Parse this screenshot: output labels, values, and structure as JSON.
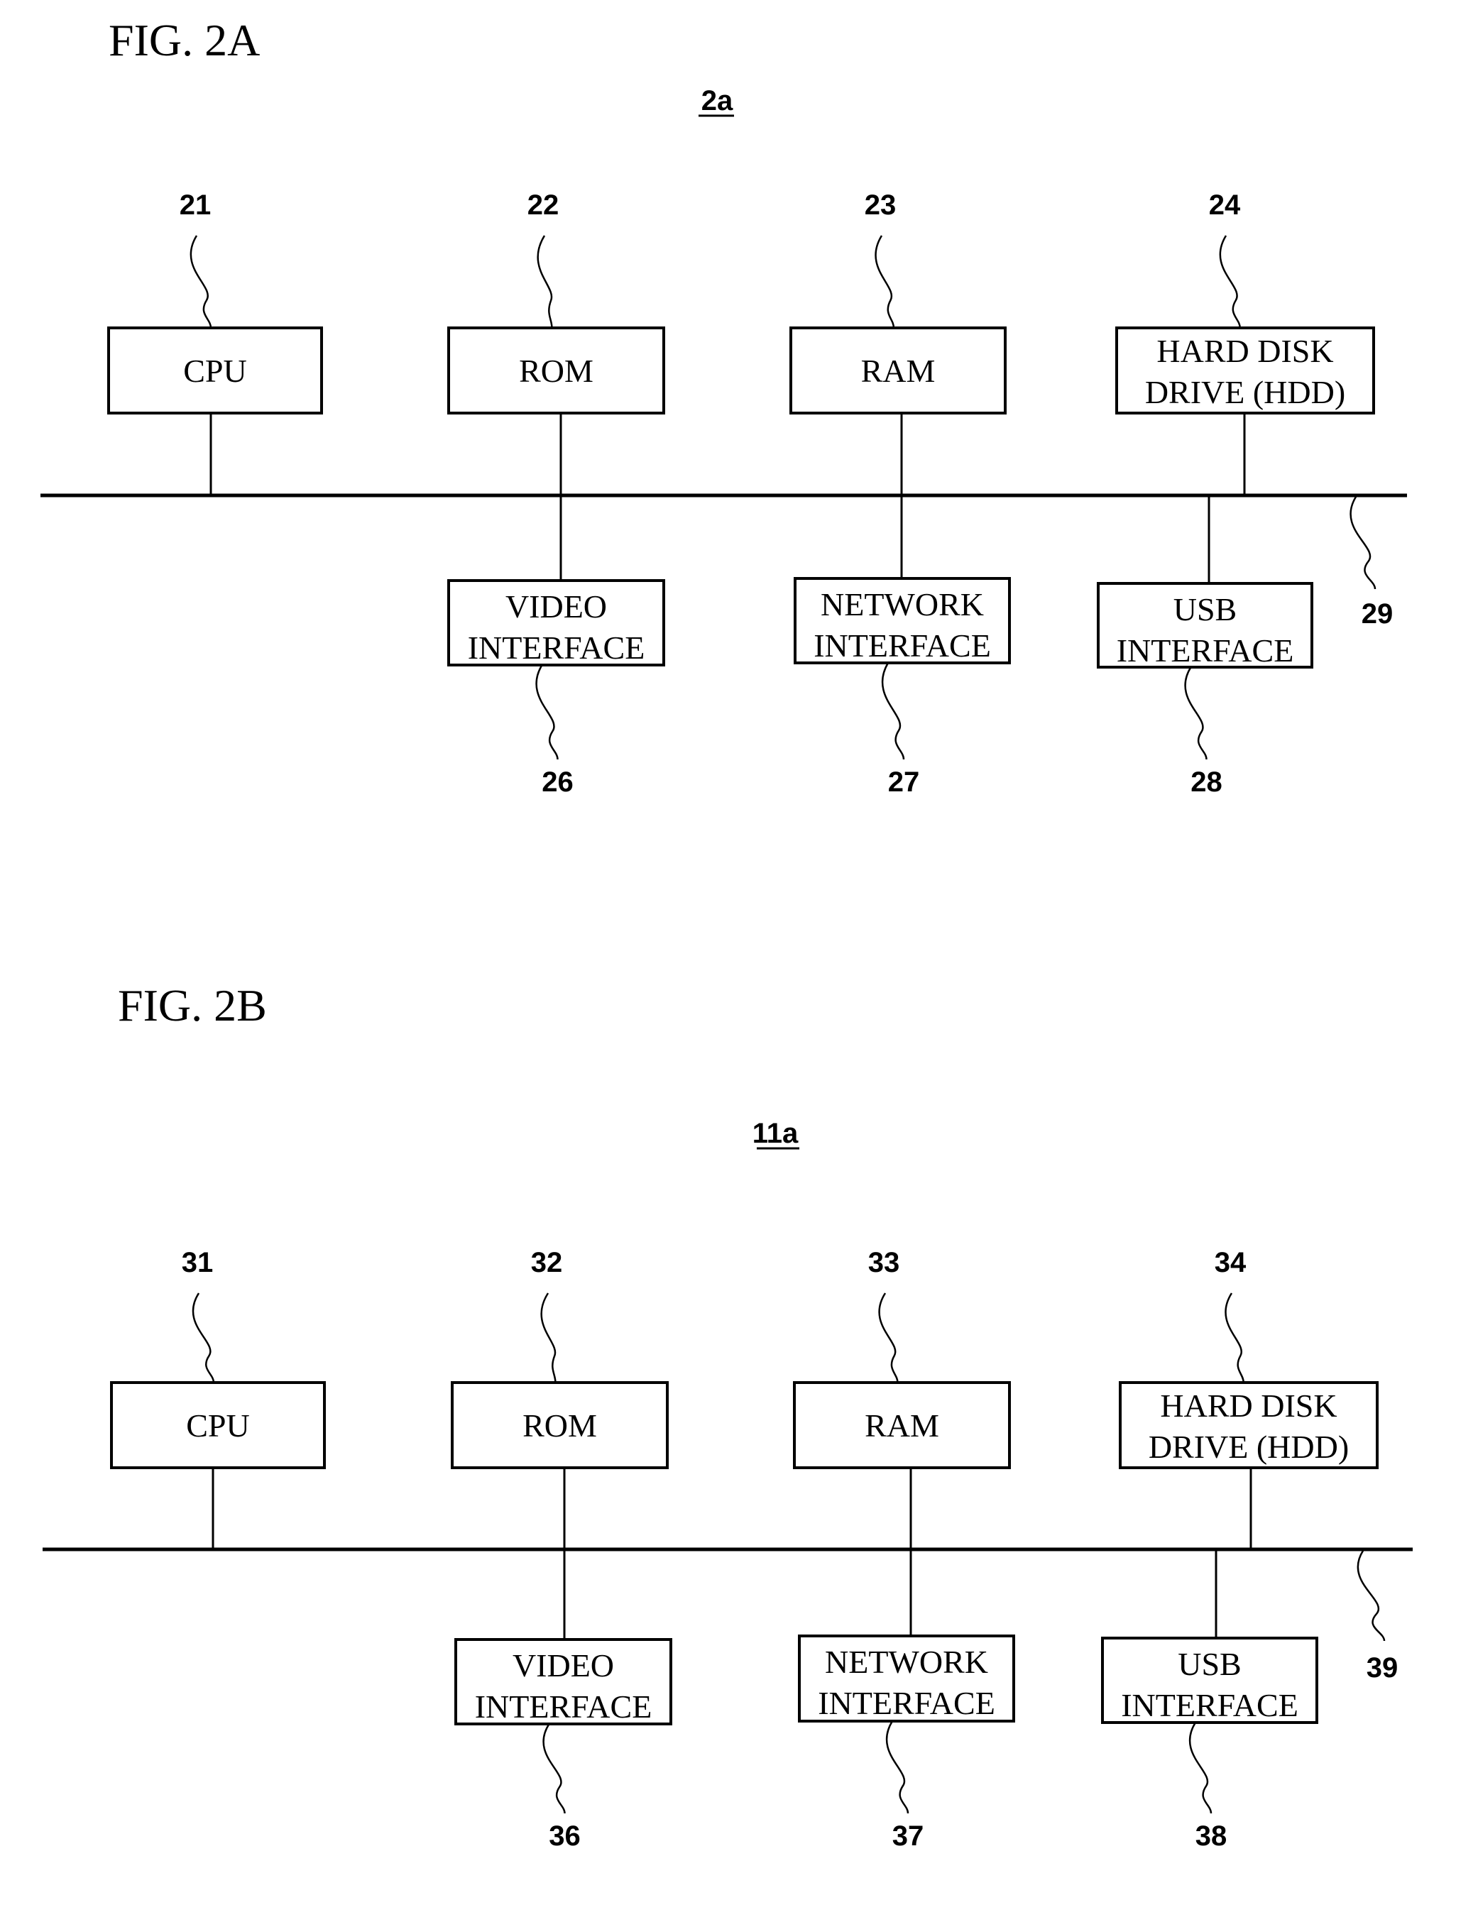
{
  "figures": [
    {
      "title": "FIG. 2A",
      "device_ref": "2a",
      "bus_ref": "29",
      "top_components": [
        {
          "ref": "21",
          "lines": [
            "CPU"
          ]
        },
        {
          "ref": "22",
          "lines": [
            "ROM"
          ]
        },
        {
          "ref": "23",
          "lines": [
            "RAM"
          ]
        },
        {
          "ref": "24",
          "lines": [
            "HARD DISK",
            "DRIVE (HDD)"
          ]
        }
      ],
      "bottom_components": [
        {
          "ref": "26",
          "lines": [
            "VIDEO",
            "INTERFACE"
          ]
        },
        {
          "ref": "27",
          "lines": [
            "NETWORK",
            "INTERFACE"
          ]
        },
        {
          "ref": "28",
          "lines": [
            "USB",
            "INTERFACE"
          ]
        }
      ]
    },
    {
      "title": "FIG. 2B",
      "device_ref": "11a",
      "bus_ref": "39",
      "top_components": [
        {
          "ref": "31",
          "lines": [
            "CPU"
          ]
        },
        {
          "ref": "32",
          "lines": [
            "ROM"
          ]
        },
        {
          "ref": "33",
          "lines": [
            "RAM"
          ]
        },
        {
          "ref": "34",
          "lines": [
            "HARD DISK",
            "DRIVE (HDD)"
          ]
        }
      ],
      "bottom_components": [
        {
          "ref": "36",
          "lines": [
            "VIDEO",
            "INTERFACE"
          ]
        },
        {
          "ref": "37",
          "lines": [
            "NETWORK",
            "INTERFACE"
          ]
        },
        {
          "ref": "38",
          "lines": [
            "USB",
            "INTERFACE"
          ]
        }
      ]
    }
  ]
}
